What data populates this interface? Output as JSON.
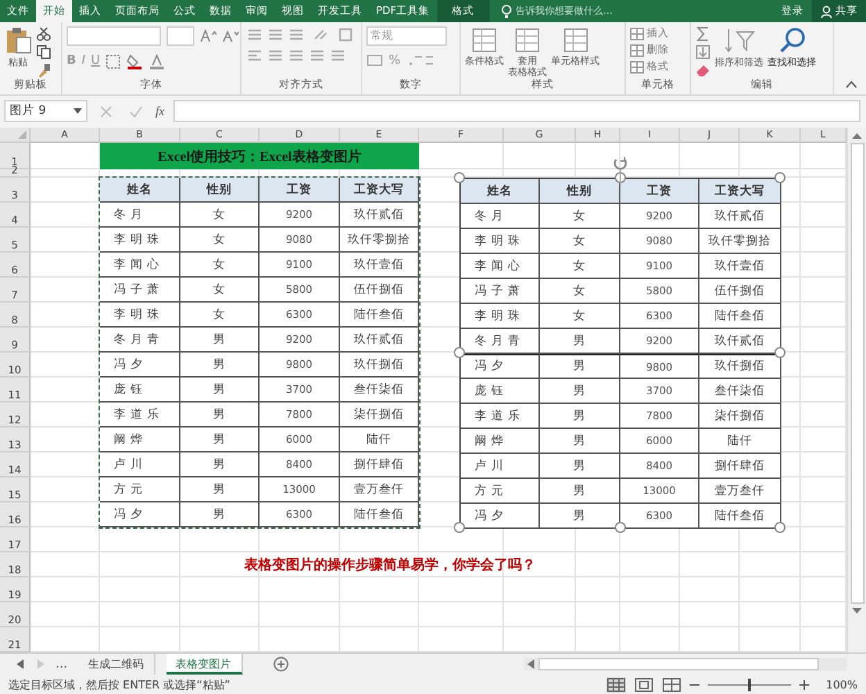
{
  "ribbon_tabs": [
    {
      "label": "文件",
      "selected": false,
      "contextual": false
    },
    {
      "label": "开始",
      "selected": true,
      "contextual": false
    },
    {
      "label": "插入",
      "selected": false,
      "contextual": false
    },
    {
      "label": "页面布局",
      "selected": false,
      "contextual": false
    },
    {
      "label": "公式",
      "selected": false,
      "contextual": false
    },
    {
      "label": "数据",
      "selected": false,
      "contextual": false
    },
    {
      "label": "审阅",
      "selected": false,
      "contextual": false
    },
    {
      "label": "视图",
      "selected": false,
      "contextual": false
    },
    {
      "label": "开发工具",
      "selected": false,
      "contextual": false
    },
    {
      "label": "PDF工具集",
      "selected": false,
      "contextual": false
    },
    {
      "label": "格式",
      "selected": false,
      "contextual": true
    }
  ],
  "tell_me": {
    "placeholder": "告诉我你想要做什么..."
  },
  "account": {
    "sign_in": "登录",
    "share": "共享"
  },
  "ribbon_groups": [
    {
      "label": "剪贴板",
      "kind": "clipboard",
      "buttons": [
        "粘贴"
      ]
    },
    {
      "label": "字体",
      "kind": "font",
      "buttons": [
        "B",
        "I",
        "U"
      ]
    },
    {
      "label": "对齐方式",
      "kind": "align"
    },
    {
      "label": "数字",
      "kind": "number",
      "buttons": [
        "常规",
        "%"
      ]
    },
    {
      "label": "样式",
      "kind": "styles",
      "buttons": [
        [
          "条件格式"
        ],
        [
          "套用",
          "表格格式"
        ],
        [
          "单元格样式"
        ]
      ]
    },
    {
      "label": "单元格",
      "kind": "cells",
      "buttons": [
        "插入",
        "删除",
        "格式"
      ]
    },
    {
      "label": "编辑",
      "kind": "editing",
      "buttons": [
        "排序和筛选",
        "查找和选择"
      ]
    }
  ],
  "formula_bar": {
    "name_box": "图片 9",
    "fx": "fx"
  },
  "columns": [
    "A",
    "B",
    "C",
    "D",
    "E",
    "F",
    "G",
    "H",
    "I",
    "J",
    "K",
    "L"
  ],
  "rows": [
    "1",
    "2",
    "3",
    "4",
    "5",
    "6",
    "7",
    "8",
    "9",
    "10",
    "11",
    "12",
    "13",
    "14",
    "15",
    "16",
    "17",
    "18",
    "19",
    "20",
    "21"
  ],
  "title": "Excel使用技巧：Excel表格变图片",
  "table": {
    "columns": [
      "姓名",
      "性别",
      "工资",
      "工资大写"
    ],
    "rows": [
      [
        "冬月",
        "女",
        "9200",
        "玖仟贰佰"
      ],
      [
        "李明珠",
        "女",
        "9080",
        "玖仟零捌拾"
      ],
      [
        "李闻心",
        "女",
        "9100",
        "玖仟壹佰"
      ],
      [
        "冯子萧",
        "女",
        "5800",
        "伍仟捌佰"
      ],
      [
        "李明珠",
        "女",
        "6300",
        "陆仟叁佰"
      ],
      [
        "冬月青",
        "男",
        "9200",
        "玖仟贰佰"
      ],
      [
        "冯夕",
        "男",
        "9800",
        "玖仟捌佰"
      ],
      [
        "庞钰",
        "男",
        "3700",
        "叁仟柒佰"
      ],
      [
        "李道乐",
        "男",
        "7800",
        "柒仟捌佰"
      ],
      [
        "阚烨",
        "男",
        "6000",
        "陆仟"
      ],
      [
        "卢川",
        "男",
        "8400",
        "捌仟肆佰"
      ],
      [
        "方元",
        "男",
        "13000",
        "壹万叁仟"
      ],
      [
        "冯夕",
        "男",
        "6300",
        "陆仟叁佰"
      ]
    ]
  },
  "picture_table": {
    "columns": [
      "姓名",
      "性别",
      "工资",
      "工资大写"
    ],
    "rows": [
      [
        "冬月",
        "女",
        "9200",
        "玖仟贰佰"
      ],
      [
        "李明珠",
        "女",
        "9080",
        "玖仟零捌拾"
      ],
      [
        "李闻心",
        "女",
        "9100",
        "玖仟壹佰"
      ],
      [
        "冯子萧",
        "女",
        "5800",
        "伍仟捌佰"
      ],
      [
        "李明珠",
        "女",
        "6300",
        "陆仟叁佰"
      ],
      [
        "冬月青",
        "男",
        "9200",
        "玖仟贰佰"
      ],
      [
        "冯夕",
        "男",
        "9800",
        "玖仟捌佰"
      ],
      [
        "庞钰",
        "男",
        "3700",
        "叁仟柒佰"
      ],
      [
        "李道乐",
        "男",
        "7800",
        "柒仟捌佰"
      ],
      [
        "阚烨",
        "男",
        "6000",
        "陆仟"
      ],
      [
        "卢川",
        "男",
        "8400",
        "捌仟肆佰"
      ],
      [
        "方元",
        "男",
        "13000",
        "壹万叁仟"
      ],
      [
        "冯夕",
        "男",
        "6300",
        "陆仟叁佰"
      ]
    ]
  },
  "note": "表格变图片的操作步骤简单易学，你学会了吗？",
  "sheet_tabs": [
    {
      "label": "生成二维码",
      "selected": false
    },
    {
      "label": "表格变图片",
      "selected": true
    }
  ],
  "sheet_tabs_more": "...",
  "status_bar": {
    "message": "选定目标区域，然后按 ENTER 或选择“粘贴”",
    "zoom": {
      "level": 0.5,
      "reading": "100%"
    }
  }
}
